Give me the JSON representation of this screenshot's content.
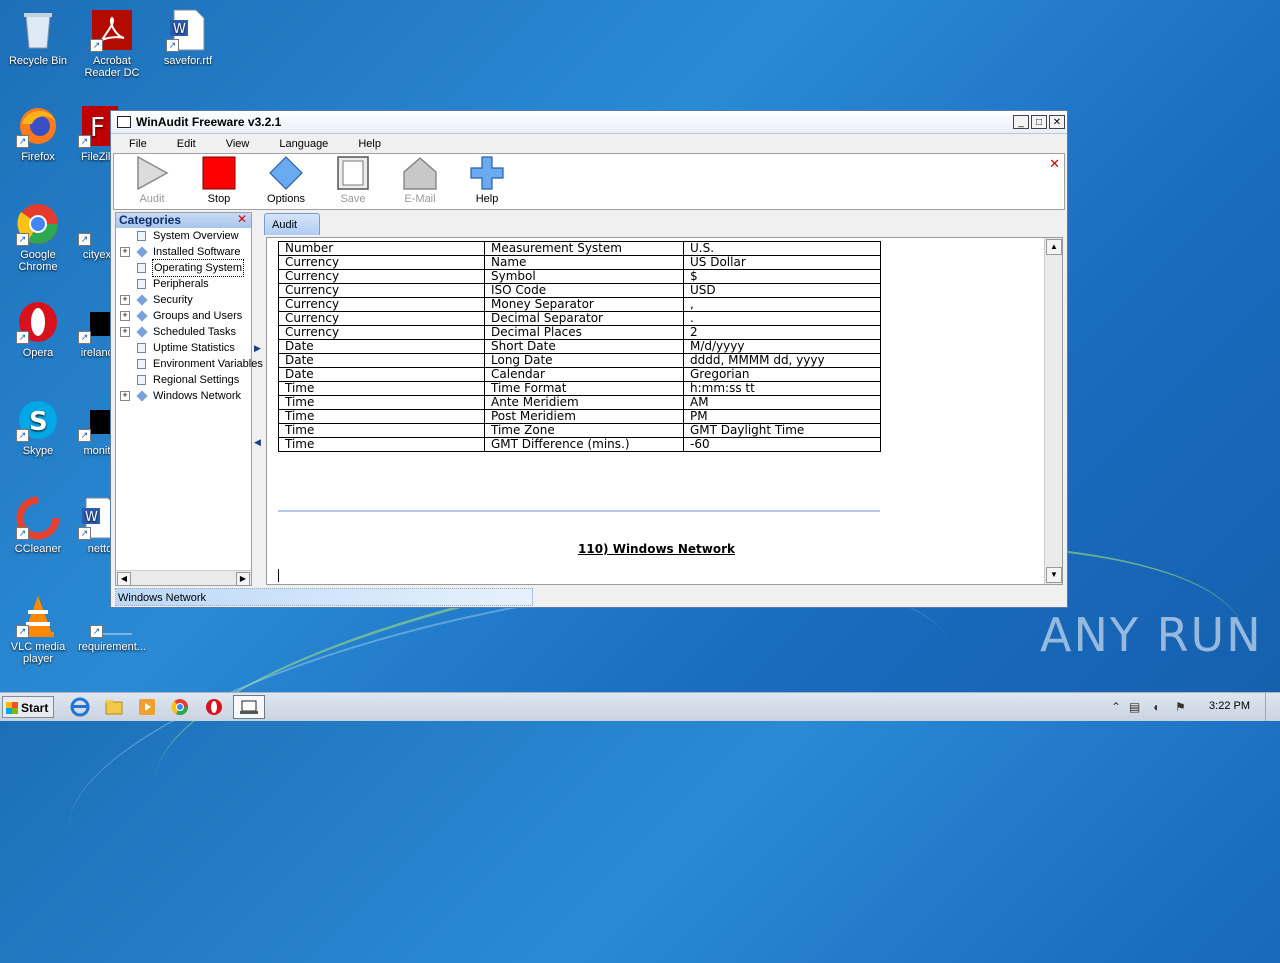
{
  "desktop": {
    "icons": [
      {
        "label": "Recycle Bin"
      },
      {
        "label": "Acrobat Reader DC"
      },
      {
        "label": "savefor.rtf"
      },
      {
        "label": "Firefox"
      },
      {
        "label": "FileZilla"
      },
      {
        "label": "Google Chrome"
      },
      {
        "label": "cityexp"
      },
      {
        "label": "Opera"
      },
      {
        "label": "irelandv"
      },
      {
        "label": "Skype"
      },
      {
        "label": "monito"
      },
      {
        "label": "CCleaner"
      },
      {
        "label": "netto"
      },
      {
        "label": "VLC media player"
      },
      {
        "label": "requirement..."
      }
    ]
  },
  "window": {
    "title": "WinAudit Freeware v3.2.1",
    "buttons": {
      "minimize": "_",
      "maximize": "□",
      "close": "✕"
    },
    "menu": [
      "File",
      "Edit",
      "View",
      "Language",
      "Help"
    ],
    "toolbar": [
      {
        "label": "Audit",
        "icon": "play-icon",
        "enabled": false
      },
      {
        "label": "Stop",
        "icon": "stop-icon",
        "enabled": true
      },
      {
        "label": "Options",
        "icon": "options-icon",
        "enabled": true
      },
      {
        "label": "Save",
        "icon": "save-icon",
        "enabled": false
      },
      {
        "label": "E-Mail",
        "icon": "email-icon",
        "enabled": false
      },
      {
        "label": "Help",
        "icon": "help-icon",
        "enabled": true
      }
    ],
    "toolbar_close": "✕",
    "categories": {
      "title": "Categories",
      "close": "✕",
      "items": [
        {
          "label": "System Overview",
          "expandable": false,
          "icon": "document-icon",
          "selected": false
        },
        {
          "label": "Installed Software",
          "expandable": true,
          "icon": "diamond-icon",
          "selected": false
        },
        {
          "label": "Operating System",
          "expandable": false,
          "icon": "document-icon",
          "selected": true
        },
        {
          "label": "Peripherals",
          "expandable": false,
          "icon": "document-icon",
          "selected": false
        },
        {
          "label": "Security",
          "expandable": true,
          "icon": "diamond-icon",
          "selected": false
        },
        {
          "label": "Groups and Users",
          "expandable": true,
          "icon": "diamond-icon",
          "selected": false
        },
        {
          "label": "Scheduled Tasks",
          "expandable": true,
          "icon": "diamond-icon",
          "selected": false
        },
        {
          "label": "Uptime Statistics",
          "expandable": false,
          "icon": "document-icon",
          "selected": false
        },
        {
          "label": "Environment Variables",
          "expandable": false,
          "icon": "document-icon",
          "selected": false
        },
        {
          "label": "Regional Settings",
          "expandable": false,
          "icon": "document-icon",
          "selected": false
        },
        {
          "label": "Windows Network",
          "expandable": true,
          "icon": "diamond-icon",
          "selected": false
        }
      ]
    },
    "tab": "Audit",
    "table": [
      [
        "Number",
        "Measurement System",
        "U.S."
      ],
      [
        "Currency",
        "Name",
        "US Dollar"
      ],
      [
        "Currency",
        "Symbol",
        "$"
      ],
      [
        "Currency",
        "ISO Code",
        "USD"
      ],
      [
        "Currency",
        "Money Separator",
        ","
      ],
      [
        "Currency",
        "Decimal Separator",
        "."
      ],
      [
        "Currency",
        "Decimal Places",
        "2"
      ],
      [
        "Date",
        "Short Date",
        "M/d/yyyy"
      ],
      [
        "Date",
        "Long Date",
        "dddd, MMMM dd, yyyy"
      ],
      [
        "Date",
        "Calendar",
        "Gregorian"
      ],
      [
        "Time",
        "Time Format",
        "h:mm:ss tt"
      ],
      [
        "Time",
        "Ante Meridiem",
        "AM"
      ],
      [
        "Time",
        "Post Meridiem",
        "PM"
      ],
      [
        "Time",
        "Time Zone",
        "GMT Daylight Time"
      ],
      [
        "Time",
        "GMT Difference (mins.)",
        "-60"
      ]
    ],
    "section_title": "110) Windows Network",
    "status": "Windows Network"
  },
  "taskbar": {
    "start_label": "Start",
    "clock": "3:22 PM"
  },
  "watermark": "ANY RUN",
  "colors": {
    "stop_red": "#ff0000",
    "accent_blue": "#5b9de6",
    "desktop_blue": "#1d6fb8"
  }
}
